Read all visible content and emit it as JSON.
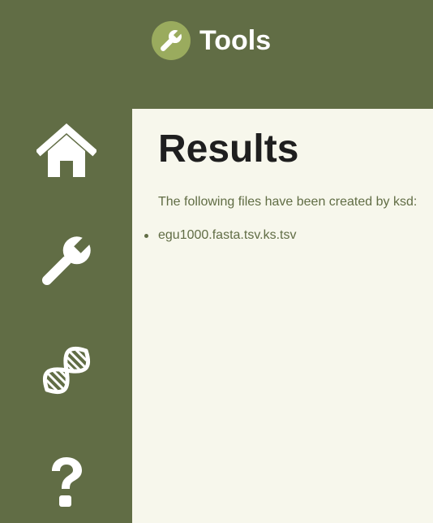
{
  "header": {
    "title": "Tools",
    "logo_icon": "wrench-icon"
  },
  "sidebar": {
    "items": [
      {
        "name": "home",
        "icon": "house-icon"
      },
      {
        "name": "tools",
        "icon": "wrench-icon"
      },
      {
        "name": "dna",
        "icon": "dna-helix-icon"
      },
      {
        "name": "help",
        "icon": "question-mark-icon"
      }
    ]
  },
  "main": {
    "title": "Results",
    "intro": "The following files have been created by ksd:",
    "files": [
      "egu1000.fasta.tsv.ks.tsv"
    ]
  },
  "colors": {
    "sidebar_bg": "#616d45",
    "content_bg": "#f7f7ec",
    "logo_circle": "#9aab5e",
    "text_accent": "#616d45",
    "heading": "#1f1f1f"
  }
}
